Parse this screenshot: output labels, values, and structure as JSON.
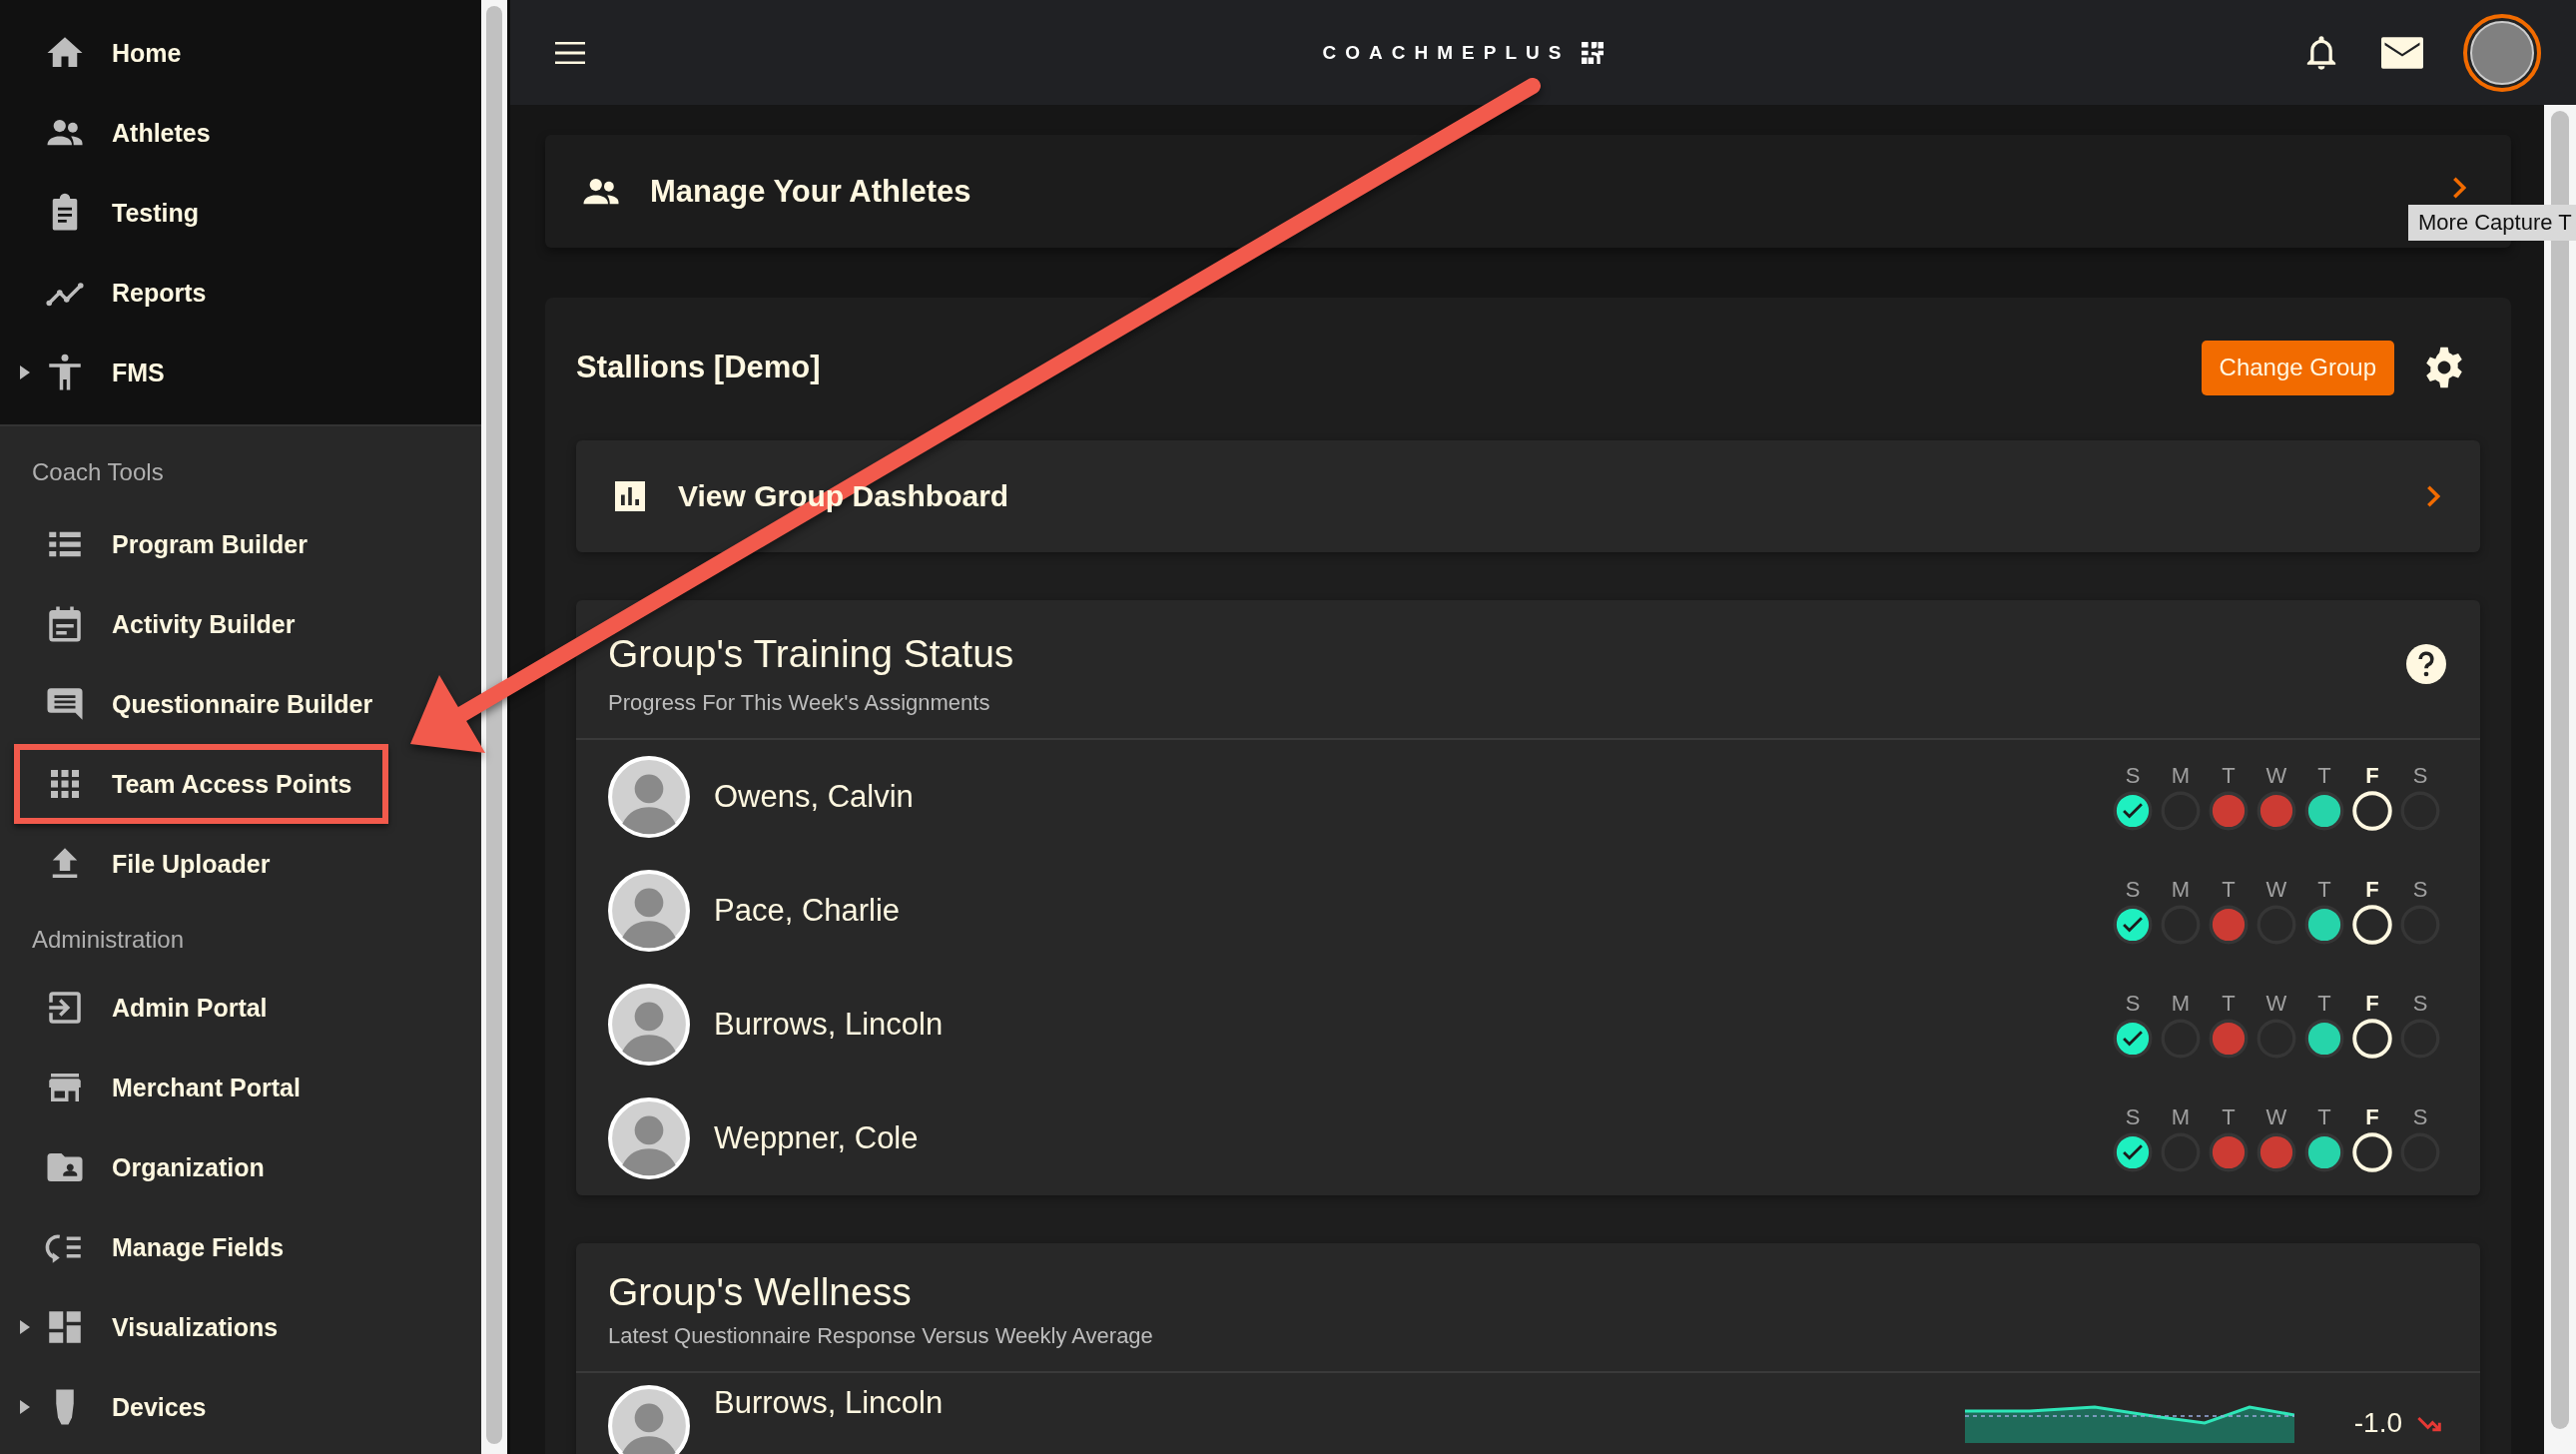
{
  "header": {
    "logo": "COACHMEPLUS"
  },
  "sidebar": {
    "primary": [
      {
        "label": "Home",
        "expandable": false,
        "highlighted": false
      },
      {
        "label": "Athletes",
        "expandable": false,
        "highlighted": false
      },
      {
        "label": "Testing",
        "expandable": false,
        "highlighted": false
      },
      {
        "label": "Reports",
        "expandable": false,
        "highlighted": false
      },
      {
        "label": "FMS",
        "expandable": true,
        "highlighted": false
      }
    ],
    "sections": [
      {
        "title": "Coach Tools",
        "items": [
          {
            "label": "Program Builder",
            "expandable": false,
            "highlighted": false
          },
          {
            "label": "Activity Builder",
            "expandable": false,
            "highlighted": false
          },
          {
            "label": "Questionnaire Builder",
            "expandable": false,
            "highlighted": false
          },
          {
            "label": "Team Access Points",
            "expandable": false,
            "highlighted": true
          },
          {
            "label": "File Uploader",
            "expandable": false,
            "highlighted": false
          }
        ]
      },
      {
        "title": "Administration",
        "items": [
          {
            "label": "Admin Portal",
            "expandable": false,
            "highlighted": false
          },
          {
            "label": "Merchant Portal",
            "expandable": false,
            "highlighted": false
          },
          {
            "label": "Organization",
            "expandable": false,
            "highlighted": false
          },
          {
            "label": "Manage Fields",
            "expandable": false,
            "highlighted": false
          },
          {
            "label": "Visualizations",
            "expandable": true,
            "highlighted": false
          },
          {
            "label": "Devices",
            "expandable": true,
            "highlighted": false
          }
        ]
      }
    ]
  },
  "manage_card": {
    "title": "Manage Your Athletes"
  },
  "tooltip": "More Capture T",
  "group": {
    "name": "Stallions [Demo]",
    "change_button": "Change Group",
    "dashboard_link": "View Group Dashboard",
    "training": {
      "title": "Group's Training Status",
      "subtitle": "Progress For This Week's Assignments",
      "athletes": [
        {
          "name": "Owens, Calvin",
          "days": [
            {
              "label": "S",
              "kind": "checked",
              "today": false
            },
            {
              "label": "M",
              "kind": "empty",
              "today": false
            },
            {
              "label": "T",
              "kind": "missed",
              "today": false
            },
            {
              "label": "W",
              "kind": "missed",
              "today": false
            },
            {
              "label": "T",
              "kind": "done",
              "today": false
            },
            {
              "label": "F",
              "kind": "empty",
              "today": true
            },
            {
              "label": "S",
              "kind": "empty",
              "today": false
            }
          ]
        },
        {
          "name": "Pace, Charlie",
          "days": [
            {
              "label": "S",
              "kind": "checked",
              "today": false
            },
            {
              "label": "M",
              "kind": "empty",
              "today": false
            },
            {
              "label": "T",
              "kind": "missed",
              "today": false
            },
            {
              "label": "W",
              "kind": "empty",
              "today": false
            },
            {
              "label": "T",
              "kind": "done",
              "today": false
            },
            {
              "label": "F",
              "kind": "empty",
              "today": true
            },
            {
              "label": "S",
              "kind": "empty",
              "today": false
            }
          ]
        },
        {
          "name": "Burrows, Lincoln",
          "days": [
            {
              "label": "S",
              "kind": "checked",
              "today": false
            },
            {
              "label": "M",
              "kind": "empty",
              "today": false
            },
            {
              "label": "T",
              "kind": "missed",
              "today": false
            },
            {
              "label": "W",
              "kind": "empty",
              "today": false
            },
            {
              "label": "T",
              "kind": "done",
              "today": false
            },
            {
              "label": "F",
              "kind": "empty",
              "today": true
            },
            {
              "label": "S",
              "kind": "empty",
              "today": false
            }
          ]
        },
        {
          "name": "Weppner, Cole",
          "days": [
            {
              "label": "S",
              "kind": "checked",
              "today": false
            },
            {
              "label": "M",
              "kind": "empty",
              "today": false
            },
            {
              "label": "T",
              "kind": "missed",
              "today": false
            },
            {
              "label": "W",
              "kind": "missed",
              "today": false
            },
            {
              "label": "T",
              "kind": "done",
              "today": false
            },
            {
              "label": "F",
              "kind": "empty",
              "today": true
            },
            {
              "label": "S",
              "kind": "empty",
              "today": false
            }
          ]
        }
      ]
    },
    "wellness": {
      "title": "Group's Wellness",
      "subtitle": "Latest Questionnaire Response Versus Weekly Average",
      "athletes": [
        {
          "name": "Burrows, Lincoln",
          "value": "-1.0",
          "kind": "falling"
        }
      ]
    }
  }
}
